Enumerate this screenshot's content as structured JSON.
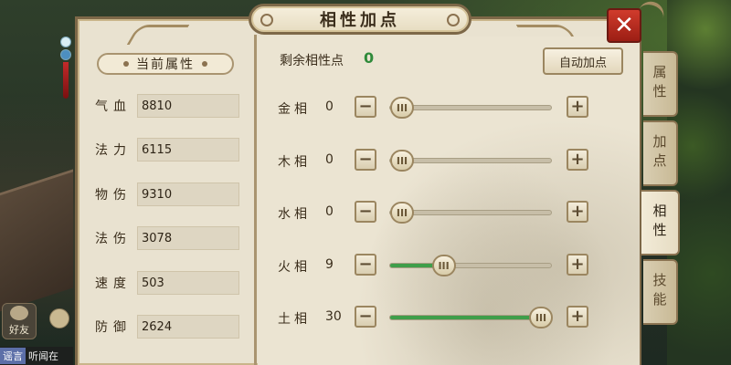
{
  "title": "相性加点",
  "close_label": "✕",
  "left_panel": {
    "header": "当前属性",
    "stats": [
      {
        "name": "气血",
        "value": "8810"
      },
      {
        "name": "法力",
        "value": "6115"
      },
      {
        "name": "物伤",
        "value": "9310"
      },
      {
        "name": "法伤",
        "value": "3078"
      },
      {
        "name": "速度",
        "value": "503"
      },
      {
        "name": "防御",
        "value": "2624"
      }
    ]
  },
  "right_panel": {
    "remaining_label": "剩余相性点",
    "remaining_value": "0",
    "auto_button": "自动加点",
    "attributes": [
      {
        "name": "金相",
        "value": "0",
        "level": 0.0
      },
      {
        "name": "木相",
        "value": "0",
        "level": 0.0
      },
      {
        "name": "水相",
        "value": "0",
        "level": 0.0
      },
      {
        "name": "火相",
        "value": "9",
        "level": 0.3
      },
      {
        "name": "土相",
        "value": "30",
        "level": 1.0
      }
    ],
    "minus_label": "−",
    "plus_label": "+"
  },
  "tabs": [
    {
      "label": "属性",
      "active": false
    },
    {
      "label": "加点",
      "active": false
    },
    {
      "label": "相性",
      "active": true
    },
    {
      "label": "技能",
      "active": false
    }
  ],
  "hud": {
    "friends_label": "好友",
    "chat_tag": "谣言",
    "chat_text": "听闻在"
  },
  "colors": {
    "slider_fill": "#3f9e4a",
    "remaining_value": "#2f8a3a",
    "close_button": "#c0302a"
  }
}
